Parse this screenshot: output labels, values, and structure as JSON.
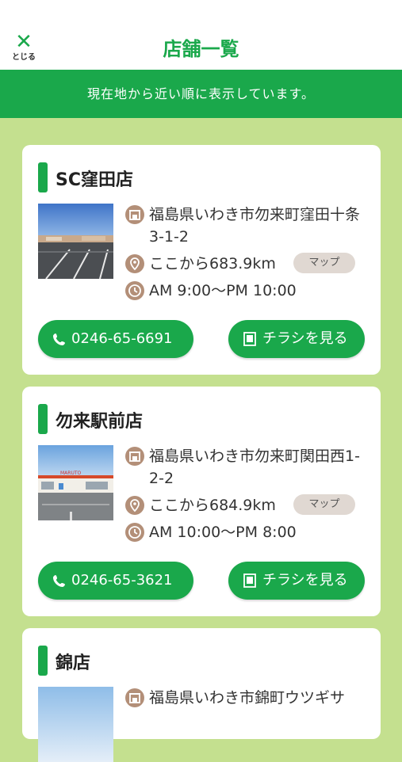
{
  "header": {
    "close_icon_glyph": "✕",
    "close_label": "とじる",
    "title": "店舗一覧"
  },
  "banner": "現在地から近い順に表示しています。",
  "stores": [
    {
      "name": "SC窪田店",
      "address": "福島県いわき市勿来町窪田十条3-1-2",
      "distance": "ここから683.9km",
      "hours": "AM 9:00〜PM 10:00",
      "map_label": "マップ",
      "phone": "0246-65-6691",
      "flyer_label": "チラシを見る"
    },
    {
      "name": "勿来駅前店",
      "address": "福島県いわき市勿来町関田西1-2-2",
      "distance": "ここから684.9km",
      "hours": "AM 10:00〜PM 8:00",
      "map_label": "マップ",
      "phone": "0246-65-3621",
      "flyer_label": "チラシを見る",
      "sign_text": "MARUTO"
    },
    {
      "name": "錦店",
      "address": "福島県いわき市錦町ウツギサ"
    }
  ],
  "colors": {
    "accent_green": "#1aa84b",
    "background_green": "#c4e08f",
    "icon_brown": "#b38f78",
    "map_button_bg": "#e0d8d2"
  }
}
